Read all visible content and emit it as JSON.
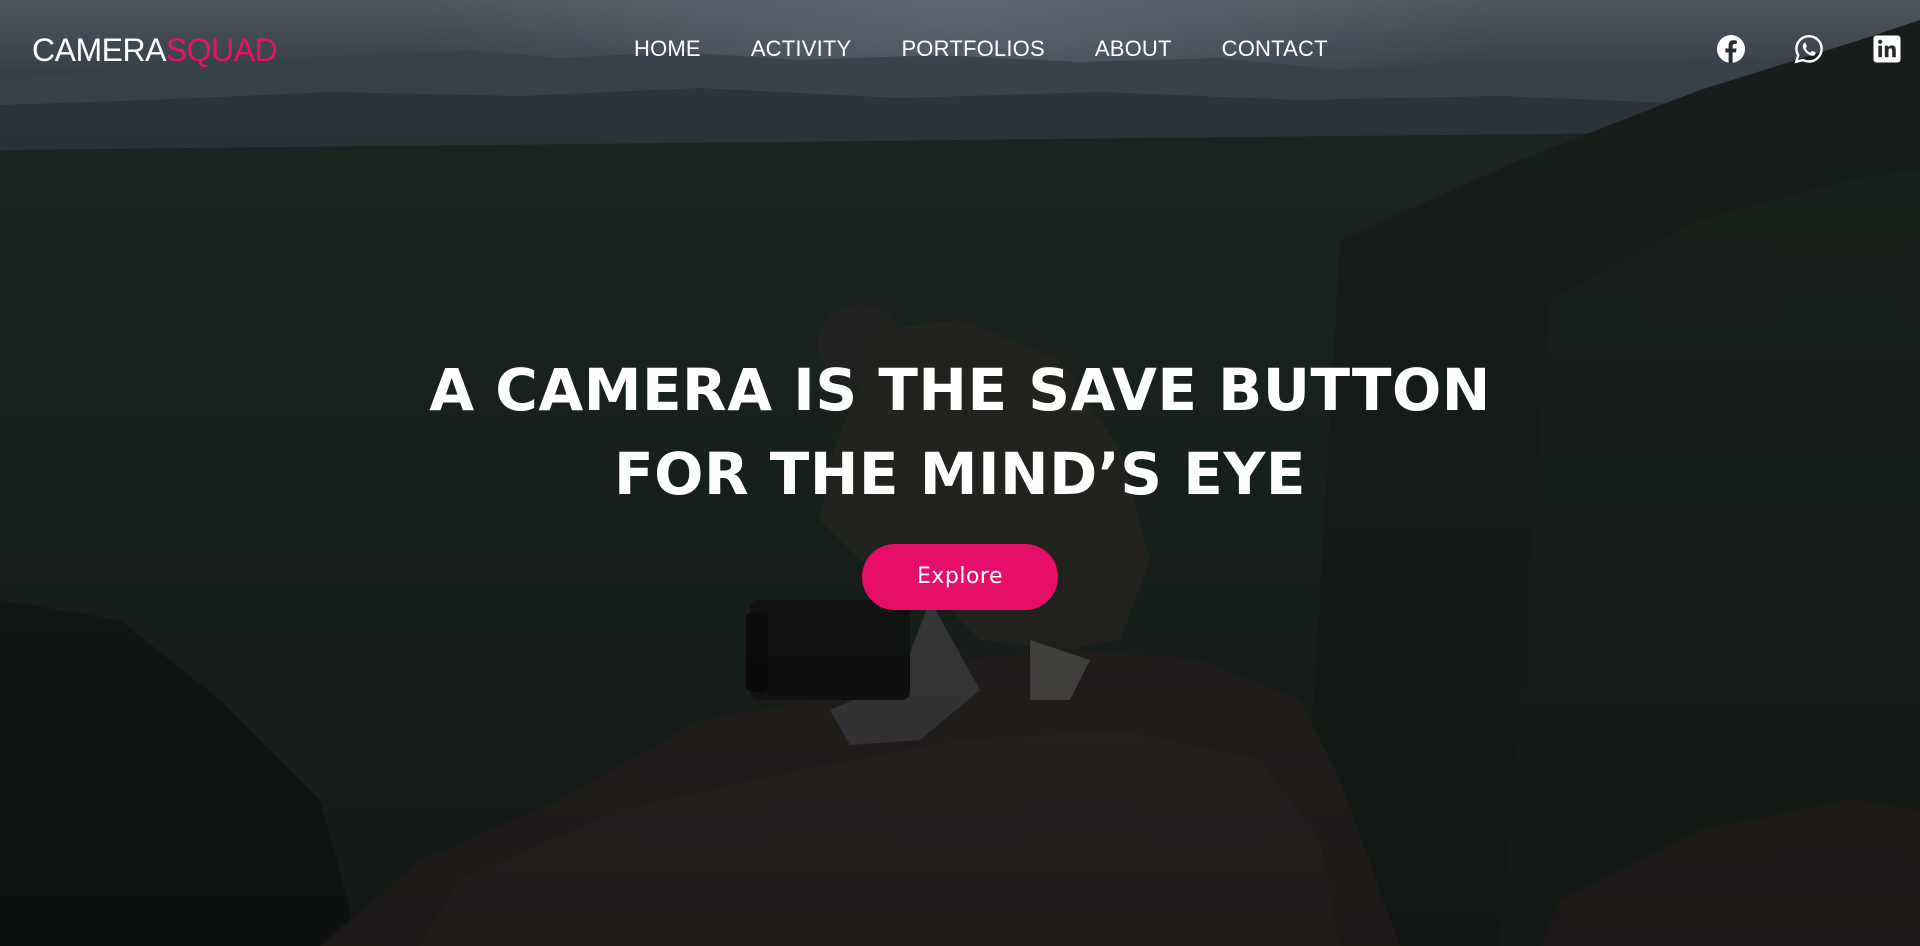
{
  "brand": {
    "part1": "CAMERA",
    "part2": "SQUAD",
    "accent_color": "#e8126c"
  },
  "nav": {
    "items": [
      {
        "label": "HOME"
      },
      {
        "label": "ACTIVITY"
      },
      {
        "label": "PORTFOLIOS"
      },
      {
        "label": "ABOUT"
      },
      {
        "label": "CONTACT"
      }
    ]
  },
  "socials": {
    "items": [
      {
        "icon": "facebook-icon"
      },
      {
        "icon": "whatsapp-icon"
      },
      {
        "icon": "linkedin-icon"
      }
    ]
  },
  "hero": {
    "headline_line1": "A CAMERA IS THE SAVE BUTTON",
    "headline_line2": "FOR THE MIND’S EYE",
    "cta_label": "Explore",
    "cta_color": "#e60e69"
  }
}
